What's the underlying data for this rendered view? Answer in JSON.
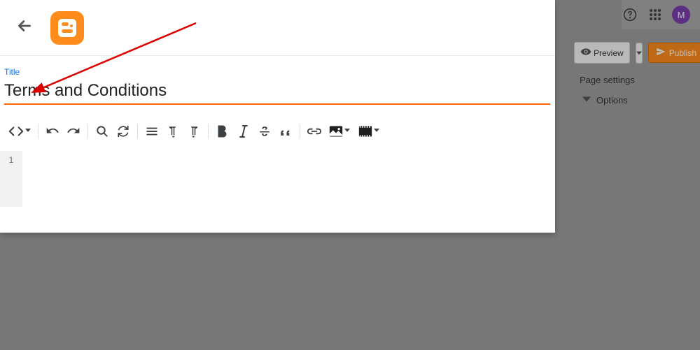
{
  "header": {
    "title_label": "Title",
    "title_value": "Terms and Conditions"
  },
  "editor": {
    "line_number": "1"
  },
  "actions": {
    "preview": "Preview",
    "publish": "Publish"
  },
  "sidebar": {
    "settings_label": "Page settings",
    "options_label": "Options"
  },
  "avatar_letter": "M"
}
